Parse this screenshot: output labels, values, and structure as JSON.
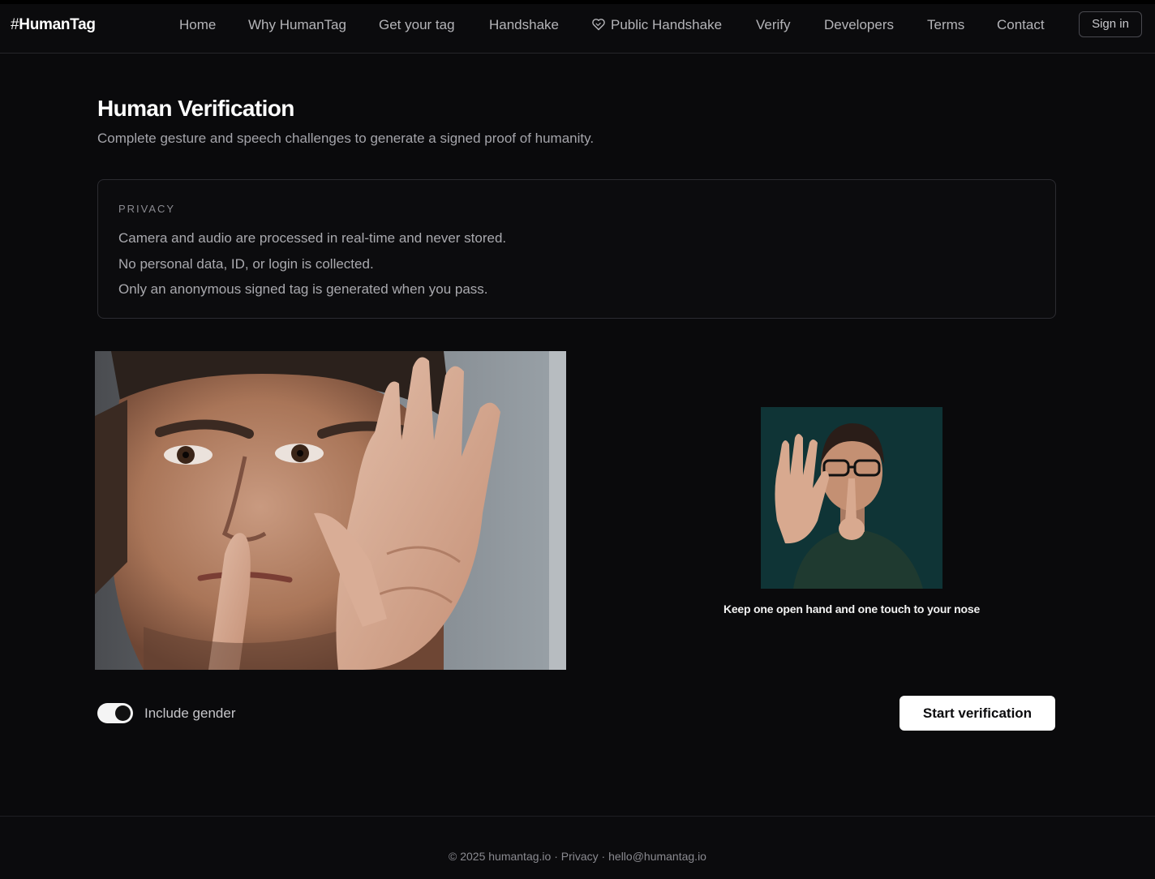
{
  "brand": {
    "hash": "#",
    "name": "HumanTag"
  },
  "nav": {
    "items": [
      "Home",
      "Why HumanTag",
      "Get your tag",
      "Handshake",
      "Public Handshake",
      "Verify",
      "Developers",
      "Terms",
      "Contact"
    ],
    "public_handshake_icon": "heart-handshake-icon",
    "sign_in": "Sign in"
  },
  "page": {
    "title": "Human Verification",
    "subtitle": "Complete gesture and speech challenges to generate a signed proof of humanity."
  },
  "privacy": {
    "heading": "PRIVACY",
    "lines": [
      "Camera and audio are processed in real-time and never stored.",
      "No personal data, ID, or login is collected.",
      "Only an anonymous signed tag is generated when you pass."
    ]
  },
  "challenge": {
    "instruction": "Keep one open hand and one touch to your nose"
  },
  "controls": {
    "include_gender_label": "Include gender",
    "include_gender_on": true,
    "start_label": "Start verification"
  },
  "footer": {
    "copyright": "© 2025 humantag.io",
    "sep": " · ",
    "privacy": "Privacy",
    "email": "hello@humantag.io"
  },
  "colors": {
    "background": "#0a0a0c",
    "primary_button": "#ffffff",
    "text_muted": "#a4a4aa"
  }
}
